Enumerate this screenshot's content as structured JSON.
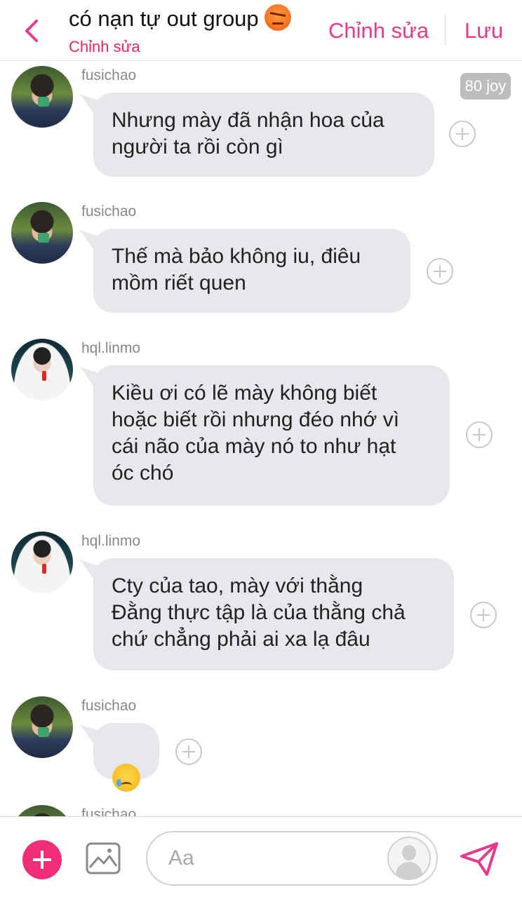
{
  "header": {
    "title": "có nạn tự out group",
    "title_emoji": "angry-face",
    "subtitle": "Chỉnh sửa",
    "edit_label": "Chỉnh sửa",
    "save_label": "Lưu"
  },
  "colors": {
    "accent": "#e8398a",
    "subtitle": "#f0245a",
    "bubble": "#e6e8eb",
    "add_button": "#ef2d78"
  },
  "joy_badge": "80 joy",
  "messages": [
    {
      "user": "fusichao",
      "text": "Nhưng mày đã nhận hoa của\nngười ta rồi còn gì"
    },
    {
      "user": "fusichao",
      "text": "Thế mà bảo không iu, điêu\nmồm riết quen"
    },
    {
      "user": "hql.linmo",
      "text": "Kiều ơi có lẽ mày không biết\nhoặc biết rồi nhưng đéo nhớ vì\ncái não của mày nó to như hạt\nóc chó"
    },
    {
      "user": "hql.linmo",
      "text": "Cty của tao, mày với thằng\nĐằng thực tập là của thằng chả\nchứ chẳng phải ai xa lạ đâu"
    },
    {
      "user": "fusichao",
      "emoji": "crying-face"
    },
    {
      "user": "fusichao"
    }
  ],
  "composer": {
    "placeholder": "Aa",
    "add_icon": "plus-icon",
    "image_icon": "image-icon",
    "send_icon": "send-icon"
  }
}
